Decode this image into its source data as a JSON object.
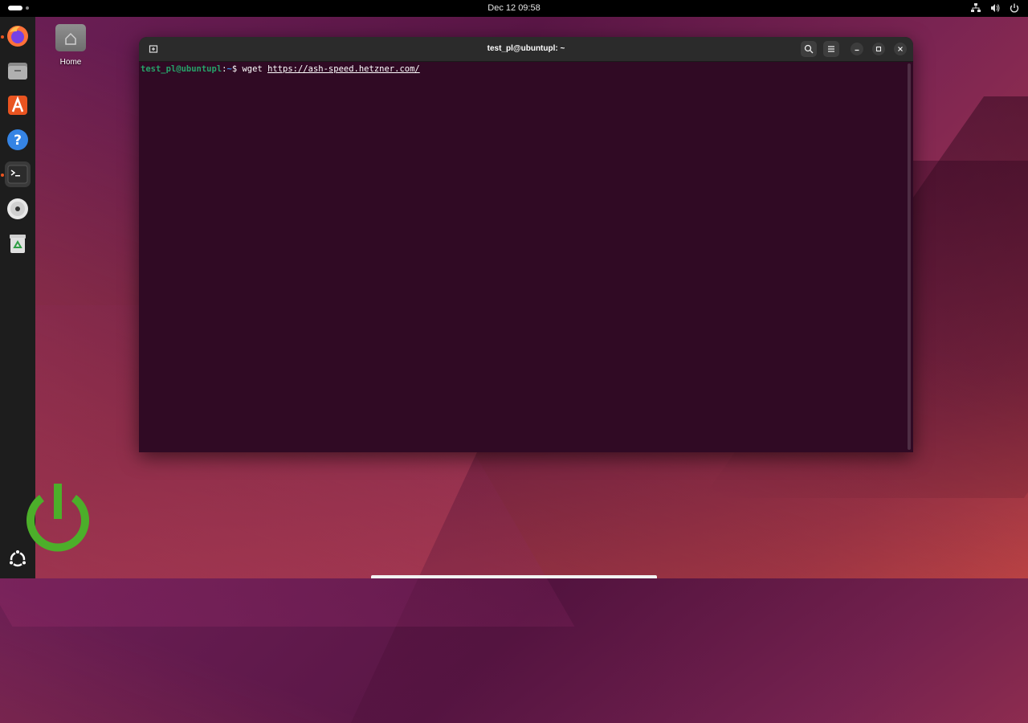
{
  "topbar": {
    "clock": "Dec 12  09:58",
    "tray_icons": [
      "network-icon",
      "volume-icon",
      "power-icon"
    ]
  },
  "dock": {
    "items": [
      {
        "name": "firefox",
        "icon": "firefox-icon",
        "running": true
      },
      {
        "name": "files",
        "icon": "files-icon",
        "running": false
      },
      {
        "name": "app-center",
        "icon": "app-center-icon",
        "running": false
      },
      {
        "name": "help",
        "icon": "help-icon",
        "running": false
      },
      {
        "name": "terminal",
        "icon": "terminal-icon",
        "running": true,
        "active": true
      },
      {
        "name": "disc",
        "icon": "disc-icon",
        "running": false
      },
      {
        "name": "trash",
        "icon": "trash-icon",
        "running": false
      }
    ],
    "show_apps_icon": "ubuntu-show-apps-icon"
  },
  "desktop": {
    "home_label": "Home"
  },
  "terminal": {
    "title": "test_pl@ubuntupl: ~",
    "prompt_user": "test_pl@ubuntupl",
    "prompt_sep": ":",
    "prompt_path": "~",
    "prompt_dollar": "$ ",
    "command": "wget ",
    "url": "https://ash-speed.hetzner.com/"
  },
  "colors": {
    "terminal_bg": "#300a24",
    "prompt_green": "#26a269",
    "path_blue": "#3b8eea",
    "accent": "#e95420",
    "power_logo": "#4caf2a"
  }
}
